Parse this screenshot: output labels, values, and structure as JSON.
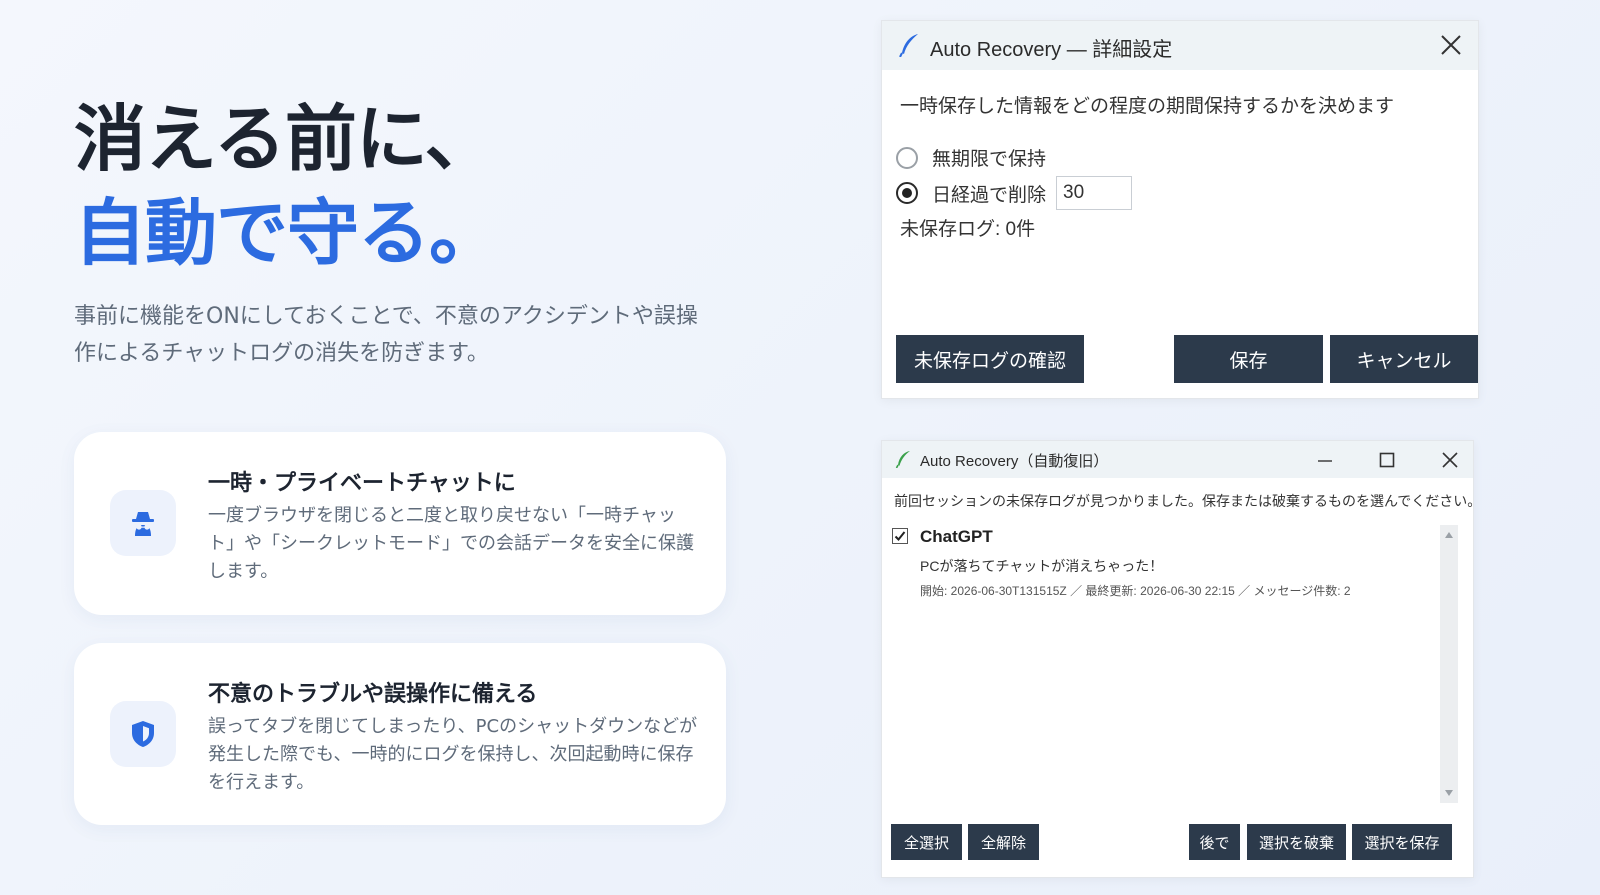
{
  "hero": {
    "line1": "消える前に、",
    "line2": "自動で守る。",
    "lead": "事前に機能をONにしておくことで、不意のアクシデントや誤操作によるチャットログの消失を防ぎます。"
  },
  "cards": [
    {
      "icon": "incognito-icon",
      "title": "一時・プライベートチャットに",
      "desc": "一度ブラウザを閉じると二度と取り戻せない「一時チャット」や「シークレットモード」での会話データを安全に保護します。"
    },
    {
      "icon": "shield-icon",
      "title": "不意のトラブルや誤操作に備える",
      "desc": "誤ってタブを閉じてしまったり、PCのシャットダウンなどが発生した際でも、一時的にログを保持し、次回起動時に保存を行えます。"
    }
  ],
  "settings_window": {
    "title": "Auto Recovery — 詳細設定",
    "prompt": "一時保存した情報をどの程度の期間保持するかを決めます",
    "option_forever": "無期限で保持",
    "option_days": "日経過で削除",
    "days_value": "30",
    "selected_option": "days",
    "status": "未保存ログ: 0件",
    "btn_check": "未保存ログの確認",
    "btn_save": "保存",
    "btn_cancel": "キャンセル"
  },
  "recovery_window": {
    "title": "Auto Recovery（自動復旧）",
    "prompt": "前回セッションの未保存ログが見つかりました。保存または破棄するものを選んでください。",
    "item": {
      "checked": true,
      "title": "ChatGPT",
      "text": "PCが落ちてチャットが消えちゃった！",
      "meta": "開始: 2026-06-30T131515Z ／ 最終更新: 2026-06-30 22:15 ／ メッセージ件数: 2"
    },
    "btn_select_all": "全選択",
    "btn_deselect_all": "全解除",
    "btn_later": "後で",
    "btn_discard": "選択を破棄",
    "btn_save_selected": "選択を保存"
  },
  "colors": {
    "accent": "#2c6be0",
    "dark_button": "#2c3a4b",
    "heading": "#1d2430"
  }
}
